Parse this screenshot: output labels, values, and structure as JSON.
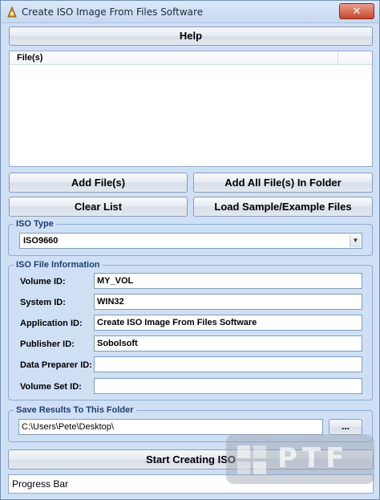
{
  "window": {
    "title": "Create ISO Image From Files Software",
    "close_label": "✕"
  },
  "toolbar": {
    "help_label": "Help"
  },
  "file_list": {
    "column_header": "File(s)"
  },
  "buttons": {
    "add_files": "Add File(s)",
    "add_folder": "Add All File(s) In Folder",
    "clear_list": "Clear List",
    "load_sample": "Load Sample/Example Files",
    "browse": "...",
    "start": "Start Creating ISO"
  },
  "iso_type": {
    "label": "ISO Type",
    "selected": "ISO9660"
  },
  "iso_info": {
    "label": "ISO File Information",
    "fields": [
      {
        "label": "Volume ID:",
        "value": "MY_VOL"
      },
      {
        "label": "System ID:",
        "value": "WIN32"
      },
      {
        "label": "Application ID:",
        "value": "Create ISO Image From Files Software"
      },
      {
        "label": "Publisher ID:",
        "value": "Sobolsoft"
      },
      {
        "label": "Data Preparer ID:",
        "value": ""
      },
      {
        "label": "Volume Set ID:",
        "value": ""
      }
    ]
  },
  "save_folder": {
    "label": "Save Results To This Folder",
    "path": "C:\\Users\\Pete\\Desktop\\"
  },
  "progress": {
    "label": "Progress Bar"
  },
  "watermark": {
    "text": "PTF"
  },
  "colors": {
    "window_bg": "#cfe0f5",
    "border": "#8faad0",
    "group_text": "#1e3d73"
  }
}
